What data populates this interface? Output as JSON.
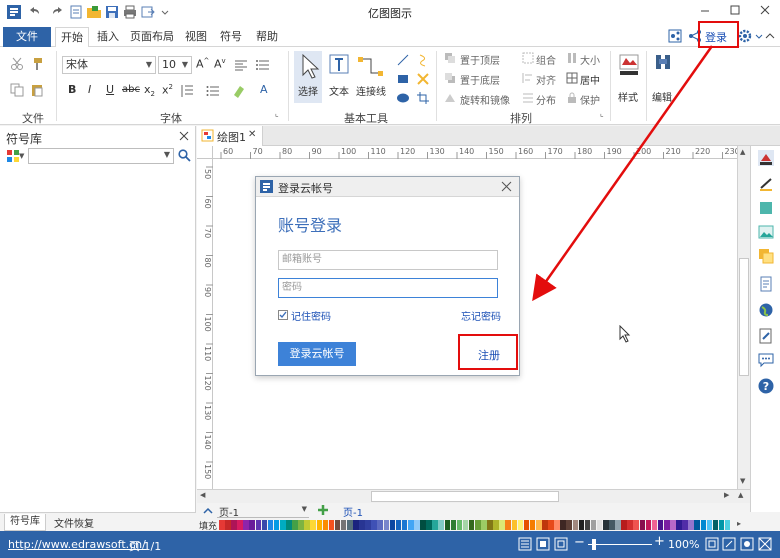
{
  "app": {
    "title": "亿图图示"
  },
  "tabs": {
    "file": "文件",
    "items": [
      "开始",
      "插入",
      "页面布局",
      "视图",
      "符号",
      "帮助"
    ],
    "login": "登录"
  },
  "ribbon": {
    "groups": {
      "file": "文件",
      "font": "字体",
      "basic_tools": "基本工具",
      "arrange": "排列"
    },
    "font_name": "宋体",
    "font_size": "10",
    "tools": {
      "select": "选择",
      "text": "文本",
      "connector": "连接线"
    },
    "arrange": {
      "bring_to_front": "置于顶层",
      "send_to_back": "置于底层",
      "rotate_mirror": "旋转和镜像",
      "group": "组合",
      "align": "对齐",
      "distribute": "分布",
      "size": "大小",
      "center": "居中",
      "protect": "保护"
    },
    "style": "样式",
    "edit": "编辑"
  },
  "left_panel": {
    "title": "符号库",
    "tabs": [
      "符号库",
      "文件恢复"
    ]
  },
  "document": {
    "tab": "绘图1"
  },
  "rulers": {
    "h_ticks": [
      "60",
      "70",
      "80",
      "90",
      "100",
      "110",
      "120",
      "130",
      "140",
      "150",
      "160",
      "170",
      "180",
      "190",
      "200",
      "210",
      "220",
      "230"
    ],
    "v_ticks": [
      "50",
      "60",
      "70",
      "80",
      "90",
      "100",
      "110",
      "120",
      "130",
      "140",
      "150",
      "160"
    ]
  },
  "dialog": {
    "title": "登录云帐号",
    "heading": "账号登录",
    "email_placeholder": "邮箱账号",
    "password_placeholder": "密码",
    "remember": "记住密码",
    "forgot": "忘记密码",
    "login_button": "登录云帐号",
    "register": "注册"
  },
  "page_bar": {
    "page_select": "页-1",
    "page_tab": "页-1",
    "fill_label": "填充"
  },
  "status": {
    "url": "http://www.edrawsoft.cn/",
    "page": "页 1/1",
    "zoom": "100%"
  },
  "colors": {
    "brand": "#2e63a7",
    "link": "#1a4fb5",
    "annotation": "#e30d0d",
    "dialog_heading": "#3d6fba",
    "dialog_button": "#3d82d8"
  },
  "palette": [
    "#e53935",
    "#c62828",
    "#ad1457",
    "#d81b60",
    "#8e24aa",
    "#6a1b9a",
    "#5e35b1",
    "#3949ab",
    "#1e88e5",
    "#039be5",
    "#00acc1",
    "#00897b",
    "#43a047",
    "#7cb342",
    "#c0ca33",
    "#fdd835",
    "#ffb300",
    "#fb8c00",
    "#f4511e",
    "#6d4c41",
    "#757575",
    "#546e7a",
    "#1a237e",
    "#283593",
    "#303f9f",
    "#3f51b5",
    "#5c6bc0",
    "#7986cb",
    "#0d47a1",
    "#1565c0",
    "#1976d2",
    "#42a5f5",
    "#90caf9",
    "#004d40",
    "#00695c",
    "#26a69a",
    "#80cbc4",
    "#1b5e20",
    "#2e7d32",
    "#66bb6a",
    "#a5d6a7",
    "#33691e",
    "#689f38",
    "#9ccc65",
    "#827717",
    "#afb42b",
    "#dce775",
    "#f57f17",
    "#fbc02d",
    "#fff176",
    "#e65100",
    "#f57c00",
    "#ffb74d",
    "#bf360c",
    "#e64a19",
    "#ff8a65",
    "#3e2723",
    "#5d4037",
    "#a1887f",
    "#212121",
    "#424242",
    "#9e9e9e",
    "#e0e0e0",
    "#263238",
    "#455a64",
    "#90a4ae",
    "#b71c1c",
    "#d32f2f",
    "#ef5350",
    "#880e4f",
    "#c2185b",
    "#f06292",
    "#4a148c",
    "#7b1fa2",
    "#ba68c8",
    "#311b92",
    "#512da8",
    "#9575cd",
    "#01579b",
    "#0288d1",
    "#4fc3f7",
    "#006064",
    "#0097a7",
    "#4dd0e1"
  ]
}
